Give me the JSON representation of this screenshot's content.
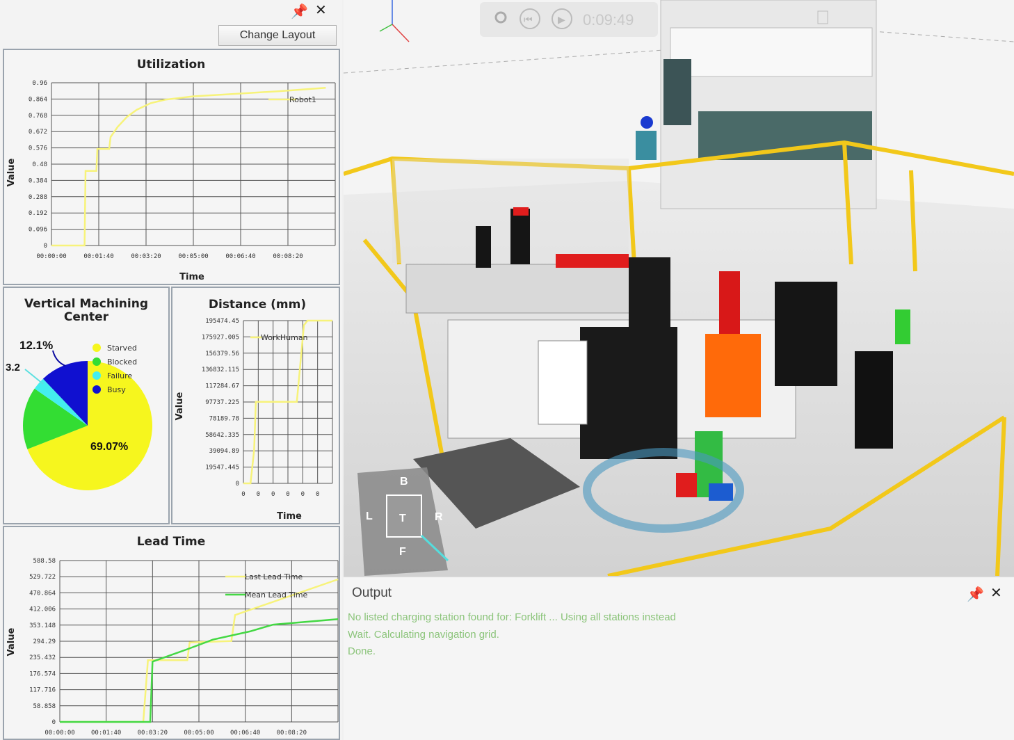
{
  "toolbar": {
    "change_layout_label": "Change Layout"
  },
  "utilization": {
    "title": "Utilization",
    "ylabel": "Value",
    "xlabel": "Time",
    "legend": "Robot1"
  },
  "vmc": {
    "title_line1": "Vertical Machining",
    "title_line2": "Center",
    "label_busy": "12.1%",
    "label_failure": "3.2",
    "label_starved": "69.07%"
  },
  "distance": {
    "title": "Distance (mm)",
    "ylabel": "Value",
    "xlabel": "Time",
    "legend": "WorkHuman"
  },
  "lead_time": {
    "title": "Lead Time",
    "ylabel": "Value",
    "legend_last": "Last Lead Time",
    "legend_mean": "Mean Lead Time"
  },
  "output": {
    "title": "Output",
    "lines": [
      "No listed charging station found for: Forklift ... Using all stations instead",
      "Wait. Calculating navigation grid.",
      "Done."
    ]
  },
  "viewport": {
    "time": "0:09:49",
    "nav_cube": {
      "top": "T",
      "left": "L",
      "right": "R",
      "back": "B",
      "front": "F"
    }
  },
  "colors": {
    "robot1": "#f7f37a",
    "last_lead": "#f7f37a",
    "mean_lead": "#44d844",
    "starved": "#f6f61e",
    "blocked": "#33dd33",
    "failure": "#44eeee",
    "busy": "#1010d0",
    "accent_yellow": "#f2c81a"
  },
  "chart_data": [
    {
      "type": "line",
      "title": "Utilization",
      "xlabel": "Time",
      "ylabel": "Value",
      "ylim": [
        0,
        0.96
      ],
      "y_ticks": [
        "0.96",
        "0.864",
        "0.768",
        "0.672",
        "0.576",
        "0.48",
        "0.384",
        "0.288",
        "0.192",
        "0.096",
        "0"
      ],
      "x_ticks": [
        "00:00:00",
        "00:01:40",
        "00:03:20",
        "00:05:00",
        "00:06:40",
        "00:08:20"
      ],
      "series": [
        {
          "name": "Robot1",
          "x": [
            0,
            70,
            72,
            95,
            97,
            122,
            125,
            140,
            160,
            180,
            210,
            240,
            300,
            360,
            420,
            480,
            580
          ],
          "y": [
            0,
            0,
            0.44,
            0.44,
            0.57,
            0.57,
            0.64,
            0.7,
            0.76,
            0.8,
            0.84,
            0.86,
            0.88,
            0.89,
            0.9,
            0.91,
            0.93
          ]
        }
      ],
      "grid": true,
      "legend": "top-right"
    },
    {
      "type": "pie",
      "title": "Vertical Machining Center",
      "legend": "top-right",
      "slices": [
        {
          "label": "Starved",
          "value": 69.07
        },
        {
          "label": "Blocked",
          "value": 15.63
        },
        {
          "label": "Failure",
          "value": 3.2
        },
        {
          "label": "Busy",
          "value": 12.1
        }
      ],
      "legend_labels": [
        "Starved",
        "Blocked",
        "Failure",
        "Busy"
      ]
    },
    {
      "type": "line",
      "title": "Distance (mm)",
      "xlabel": "Time",
      "ylabel": "Value",
      "ylim": [
        0,
        195474.45
      ],
      "y_ticks": [
        "195474.45",
        "175927.005",
        "156379.56",
        "136832.115",
        "117284.67",
        "97737.225",
        "78189.78",
        "58642.335",
        "39094.89",
        "19547.445",
        "0"
      ],
      "x_ticks": [
        "0",
        "0",
        "0",
        "0",
        "0",
        "0"
      ],
      "series": [
        {
          "name": "WorkHuman",
          "x": [
            0,
            0.08,
            0.12,
            0.14,
            0.55,
            0.6,
            0.68,
            0.72,
            1.0
          ],
          "y": [
            0,
            0,
            40000,
            98000,
            98000,
            98000,
            190000,
            195474,
            195474
          ]
        }
      ],
      "grid": true,
      "legend": "top-right"
    },
    {
      "type": "line",
      "title": "Lead Time",
      "ylabel": "Value",
      "ylim": [
        0,
        588.58
      ],
      "y_ticks": [
        "588.58",
        "529.722",
        "470.864",
        "412.006",
        "353.148",
        "294.29",
        "235.432",
        "176.574",
        "117.716",
        "58.858",
        "0"
      ],
      "x_ticks": [
        "00:00:00",
        "00:01:40",
        "00:03:20",
        "00:05:00",
        "00:06:40",
        "00:08:20"
      ],
      "series": [
        {
          "name": "Last Lead Time",
          "x": [
            0,
            180,
            190,
            275,
            280,
            370,
            378,
            600
          ],
          "y": [
            0,
            0,
            225,
            225,
            290,
            295,
            390,
            520
          ]
        },
        {
          "name": "Mean Lead Time",
          "x": [
            0,
            195,
            200,
            275,
            330,
            410,
            460,
            600
          ],
          "y": [
            0,
            0,
            220,
            265,
            300,
            330,
            355,
            375
          ]
        }
      ],
      "grid": true,
      "legend": "top-right"
    }
  ]
}
